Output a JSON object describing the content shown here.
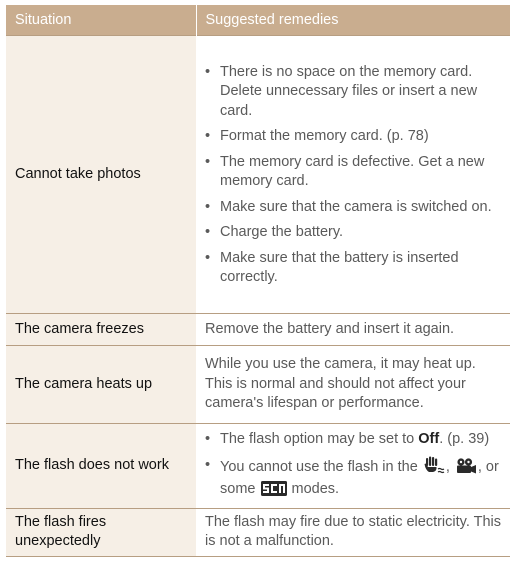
{
  "table": {
    "headers": [
      "Situation",
      "Suggested remedies"
    ],
    "rows": {
      "photos": {
        "situation": "Cannot take photos",
        "bullets": [
          "There is no space on the memory card. Delete unnecessary files or insert a new card.",
          "Format the memory card. (p. 78)",
          "The memory card is defective. Get a new memory card.",
          "Make sure that the camera is switched on.",
          "Charge the battery.",
          "Make sure that the battery is inserted correctly."
        ]
      },
      "freezes": {
        "situation": "The camera freezes",
        "remedy": "Remove the battery and insert it again."
      },
      "heats": {
        "situation": "The camera heats up",
        "remedy": "While you use the camera, it may heat up. This is normal and should not affect your camera's lifespan or performance."
      },
      "flash": {
        "situation": "The flash does not work",
        "b1_pre": "The flash option may be set to ",
        "b1_option": "Off",
        "b1_post": ". (p. 39)",
        "b2_pre": "You cannot use the flash in the ",
        "b2_sep": ", ",
        "b2_mid": ", or some ",
        "b2_post": " modes.",
        "icons": [
          "dual-is-mode-icon",
          "movie-mode-icon",
          "scene-mode-icon"
        ]
      },
      "fires": {
        "situation": "The flash fires unexpectedly",
        "remedy": "The flash may fire due to static electricity. This is not a malfunction."
      }
    }
  },
  "colors": {
    "header_bg": "#c9ad8f",
    "situation_bg": "#f6efe6",
    "rule": "#b79e82"
  }
}
